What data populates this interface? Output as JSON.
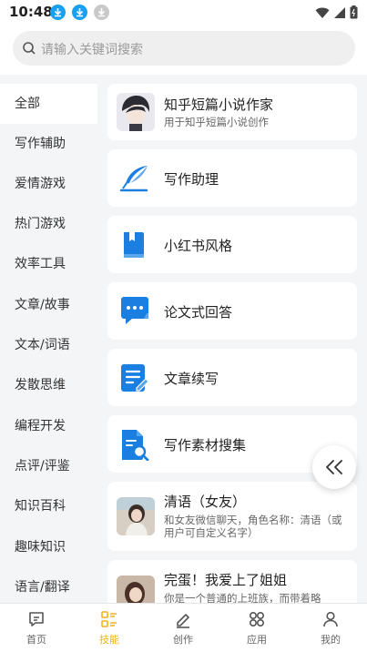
{
  "status_bar": {
    "time": "10:48"
  },
  "search": {
    "placeholder": "请输入关键词搜索"
  },
  "sidebar": {
    "items": [
      {
        "label": "全部"
      },
      {
        "label": "写作辅助"
      },
      {
        "label": "爱情游戏"
      },
      {
        "label": "热门游戏"
      },
      {
        "label": "效率工具"
      },
      {
        "label": "文章/故事"
      },
      {
        "label": "文本/词语"
      },
      {
        "label": "发散思维"
      },
      {
        "label": "编程开发"
      },
      {
        "label": "点评/评鉴"
      },
      {
        "label": "知识百科"
      },
      {
        "label": "趣味知识"
      },
      {
        "label": "语言/翻译"
      }
    ],
    "active_index": 0
  },
  "cards": [
    {
      "title": "知乎短篇小说作家",
      "desc": "用于知乎短篇小说创作",
      "icon": "avatar-anime"
    },
    {
      "title": "写作助理",
      "icon": "feather-icon"
    },
    {
      "title": "小红书风格",
      "icon": "book-icon"
    },
    {
      "title": "论文式回答",
      "icon": "chat-icon"
    },
    {
      "title": "文章续写",
      "icon": "edit-doc-icon"
    },
    {
      "title": "写作素材搜集",
      "icon": "doc-search-icon"
    },
    {
      "title": "清语（女友）",
      "desc": "和女友微信聊天，角色名称：清语（或用户可自定义名字）",
      "icon": "avatar-girl"
    },
    {
      "title": "完蛋！我爱上了姐姐",
      "desc": "你是一个普通的上班族，而带着略",
      "icon": "avatar-woman"
    }
  ],
  "tabbar": {
    "tabs": [
      {
        "label": "首页",
        "icon": "home-chat-icon"
      },
      {
        "label": "技能",
        "icon": "skills-icon"
      },
      {
        "label": "创作",
        "icon": "pen-icon"
      },
      {
        "label": "应用",
        "icon": "apps-icon"
      },
      {
        "label": "我的",
        "icon": "user-icon"
      }
    ],
    "active_index": 1
  },
  "colors": {
    "accent_blue": "#1a7fe0",
    "tab_active": "#f0b31e",
    "status_blue": "#19a0f0"
  }
}
